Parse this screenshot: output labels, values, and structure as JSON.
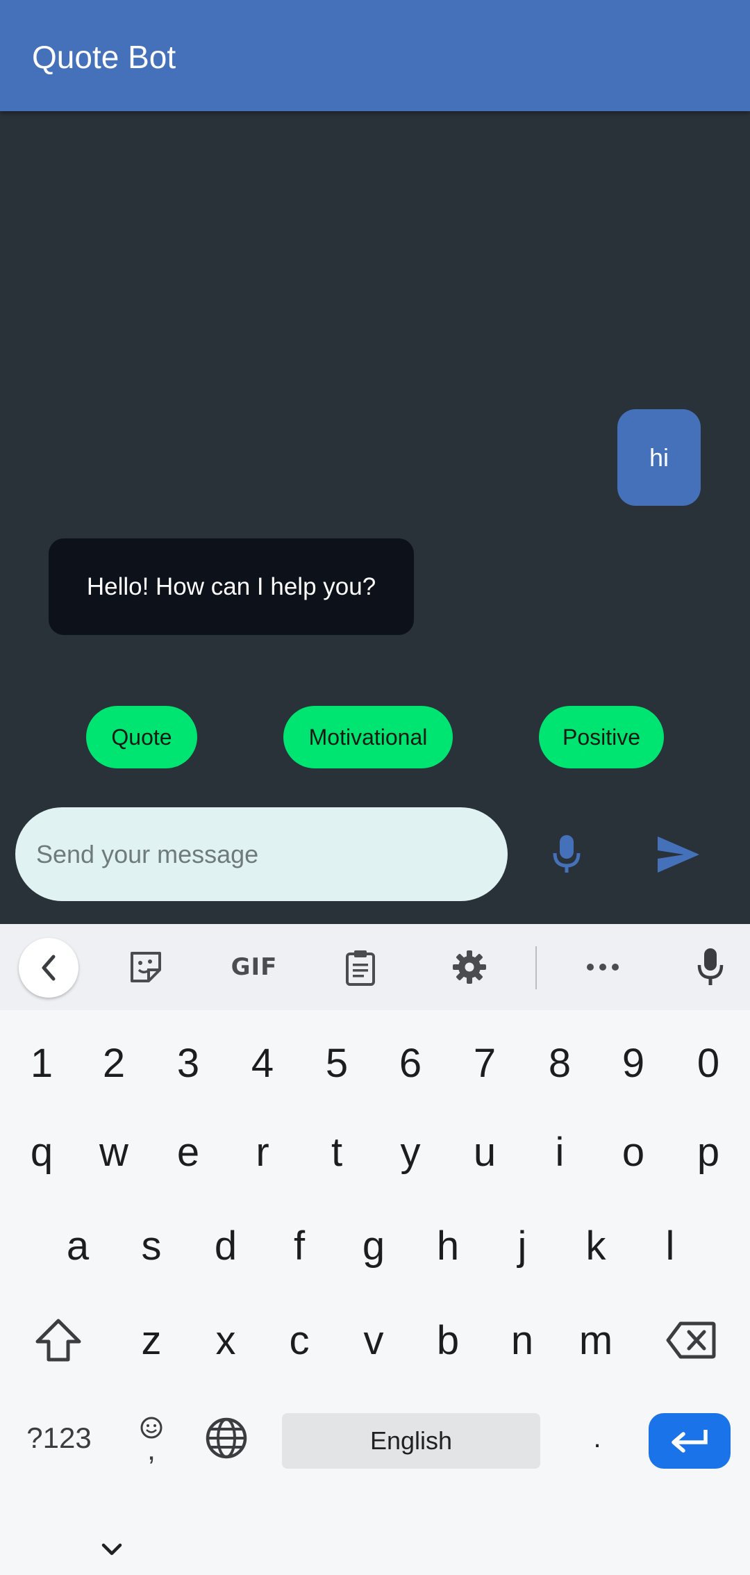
{
  "app": {
    "title": "Quote Bot"
  },
  "chat": {
    "messages": [
      {
        "from": "user",
        "text": "hi"
      },
      {
        "from": "bot",
        "text": "Hello! How can I help you?"
      }
    ],
    "chips": [
      "Quote",
      "Motivational",
      "Positive"
    ],
    "input": {
      "placeholder": "Send your message",
      "value": ""
    }
  },
  "keyboard": {
    "toolbar_icons": [
      "back-icon",
      "sticker-icon",
      "gif-icon",
      "clipboard-icon",
      "settings-icon",
      "more-icon",
      "voice-input-icon"
    ],
    "toolbar_gif_label": "GIF",
    "rows": {
      "numbers": [
        "1",
        "2",
        "3",
        "4",
        "5",
        "6",
        "7",
        "8",
        "9",
        "0"
      ],
      "row1": [
        "q",
        "w",
        "e",
        "r",
        "t",
        "y",
        "u",
        "i",
        "o",
        "p"
      ],
      "row2": [
        "a",
        "s",
        "d",
        "f",
        "g",
        "h",
        "j",
        "k",
        "l"
      ],
      "row3": [
        "z",
        "x",
        "c",
        "v",
        "b",
        "n",
        "m"
      ]
    },
    "symbols_label": "?123",
    "comma_label": ",",
    "space_label": "English",
    "period_label": "."
  },
  "colors": {
    "appbar": "#4571bb",
    "chat_bg": "#293139",
    "user_bubble": "#4571bb",
    "bot_bubble": "#0c111a",
    "chip": "#00e471",
    "input_bg": "#e0f2f1",
    "enter_key": "#1a73e8"
  }
}
